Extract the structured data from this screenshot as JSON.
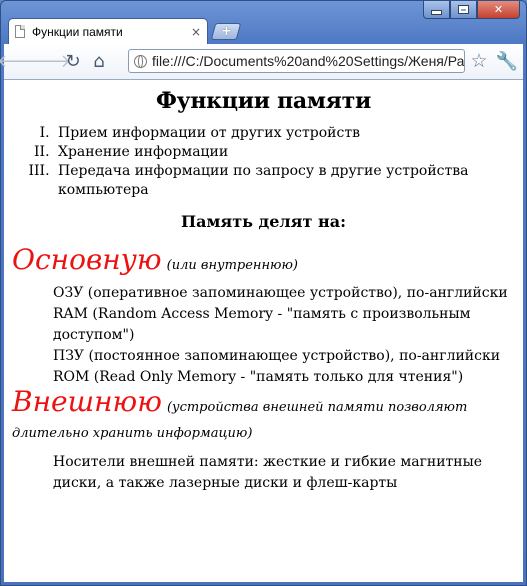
{
  "browser": {
    "tab_title": "Функции памяти",
    "tab_close": "×",
    "new_tab": "+",
    "url": "file:///C:/Documents%20and%20Settings/Женя/Ра",
    "icons": {
      "back": "back-arrow-icon",
      "forward": "forward-arrow-icon",
      "reload": "reload-icon",
      "home": "home-icon",
      "bookmark": "star-icon",
      "menu": "wrench-icon",
      "page": "page-icon",
      "site": "globe-icon"
    }
  },
  "page": {
    "title": "Функции памяти",
    "functions": [
      "Прием информации от других устройств",
      "Хранение информации",
      "Передача информации по запросу в другие устройства компьютера"
    ],
    "subtitle": "Память делят на:",
    "main_memory": {
      "name": "Основную",
      "note": "(или внутреннюю)",
      "lines": [
        "ОЗУ (оперативное запоминающее устройство), по-английски RAM (Random Access Memory - \"память с произвольным доступом\")",
        "ПЗУ (постоянное запоминающее устройство), по-английски ROM (Read Only Memory - \"память только для чтения\")"
      ]
    },
    "external_memory": {
      "name": "Внешнюю",
      "note": "(устройства внешней памяти позволяют длительно хранить информацию)",
      "lines": [
        "Носители внешней памяти: жесткие и гибкие магнитные диски, а также лазерные диски и флеш-карты"
      ]
    }
  },
  "colors": {
    "accent_red": "#ee1111",
    "frame_blue": "#4e79c4"
  }
}
